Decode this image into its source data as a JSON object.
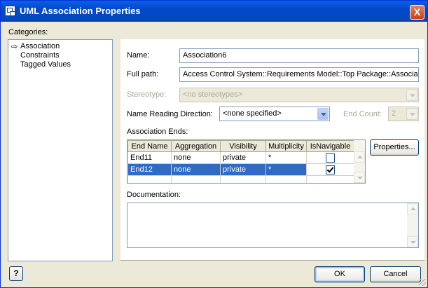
{
  "window": {
    "title": "UML Association Properties",
    "close_label": "X"
  },
  "categories": {
    "label": "Categories:",
    "items": [
      "Association",
      "Constraints",
      "Tagged Values"
    ],
    "selected": "Association"
  },
  "form": {
    "name_label": "Name:",
    "name_value": "Association6",
    "fullpath_label": "Full path:",
    "fullpath_value": "Access Control System::Requirements Model::Top Package::Associat",
    "stereotype_label": "Stereotype:",
    "stereotype_value": "<no stereotypes>",
    "reading_dir_label": "Name Reading Direction:",
    "reading_dir_value": "<none specified>",
    "end_count_label": "End Count:",
    "end_count_value": "2"
  },
  "association_ends": {
    "label": "Association Ends:",
    "columns": [
      "End Name",
      "Aggregation",
      "Visibility",
      "Multiplicity",
      "IsNavigable"
    ],
    "rows": [
      {
        "end_name": "End11",
        "aggregation": "none",
        "visibility": "private",
        "multiplicity": "*",
        "is_navigable": false
      },
      {
        "end_name": "End12",
        "aggregation": "none",
        "visibility": "private",
        "multiplicity": "*",
        "is_navigable": true
      }
    ],
    "selected_row": 1,
    "properties_button": "Properties..."
  },
  "documentation": {
    "label": "Documentation:",
    "value": ""
  },
  "footer": {
    "help_label": "?",
    "ok_label": "OK",
    "cancel_label": "Cancel"
  },
  "colors": {
    "title_bar": "#0348c8",
    "selection": "#316ac5",
    "dialog_bg": "#ece9d8",
    "close_button": "#c7421b"
  }
}
